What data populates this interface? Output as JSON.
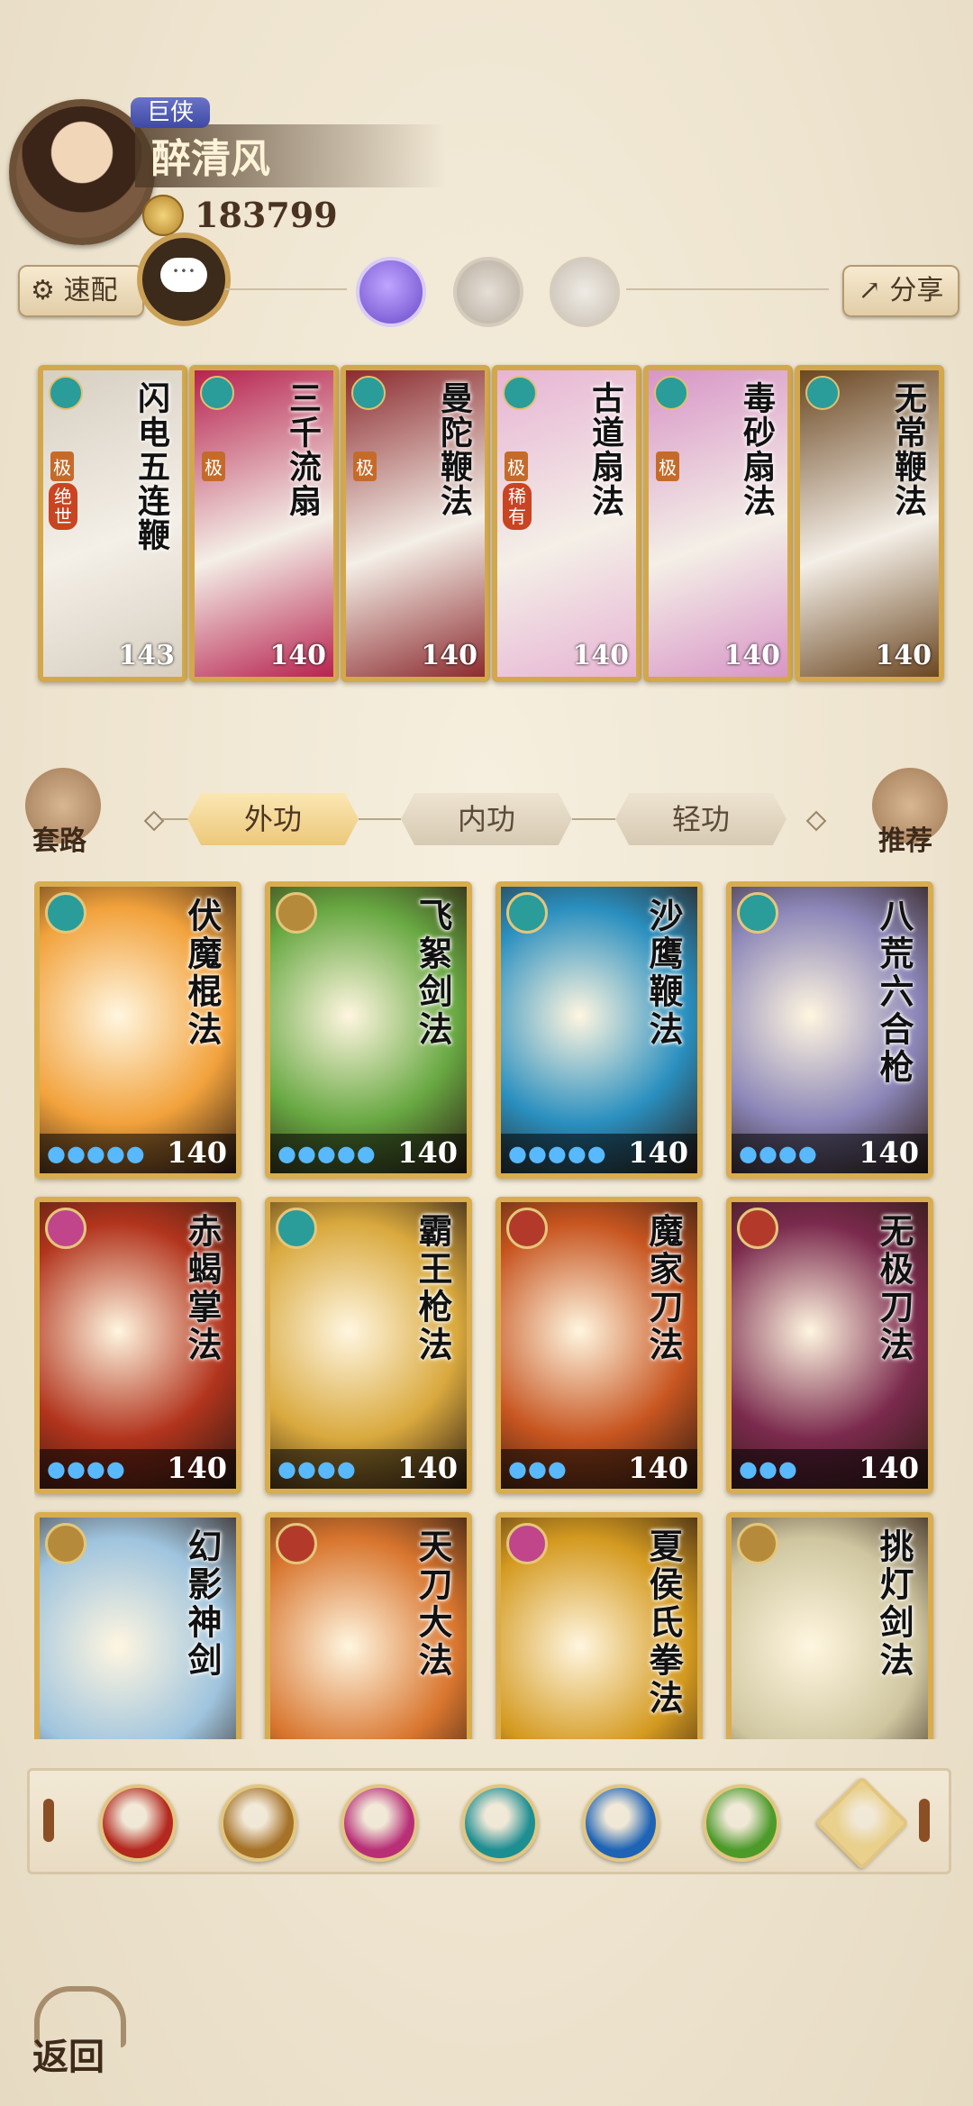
{
  "player": {
    "title_badge": "巨侠",
    "name": "醉清风",
    "currency_value": "183799"
  },
  "controls": {
    "quick_label": "速配",
    "share_label": "分享",
    "category_tabs": [
      "外功",
      "内功",
      "轻功"
    ],
    "routine_label": "套路",
    "recommend_label": "推荐",
    "back_label": "返回"
  },
  "equipped_skills": [
    {
      "name": "闪电五连鞭",
      "level": "143",
      "tag": "极",
      "tag2": "绝世",
      "color": "#d7cfc2"
    },
    {
      "name": "三千流扇",
      "level": "140",
      "tag": "极",
      "tag2": "",
      "color": "#b7224f"
    },
    {
      "name": "曼陀鞭法",
      "level": "140",
      "tag": "极",
      "tag2": "",
      "color": "#8c2b2f"
    },
    {
      "name": "古道扇法",
      "level": "140",
      "tag": "极",
      "tag2": "稀有",
      "color": "#e7b4d4"
    },
    {
      "name": "毒砂扇法",
      "level": "140",
      "tag": "极",
      "tag2": "",
      "color": "#d895c7"
    },
    {
      "name": "无常鞭法",
      "level": "140",
      "tag": "",
      "tag2": "",
      "color": "#6b4722"
    }
  ],
  "skills": [
    {
      "name": "伏魔棍法",
      "level": "140",
      "dots": "●●●●●",
      "color": "#f2a23c",
      "emblem": "#2a9c9a"
    },
    {
      "name": "飞絮剑法",
      "level": "140",
      "dots": "●●●●●",
      "color": "#68a842",
      "emblem": "#b58b3b"
    },
    {
      "name": "沙鹰鞭法",
      "level": "140",
      "dots": "●●●●●",
      "color": "#2a8fbf",
      "emblem": "#2a9c9a"
    },
    {
      "name": "八荒六合枪",
      "level": "140",
      "dots": "●●●●",
      "color": "#8b86b8",
      "emblem": "#2a9c9a"
    },
    {
      "name": "赤蝎掌法",
      "level": "140",
      "dots": "●●●●",
      "color": "#b2341d",
      "emblem": "#c0458b"
    },
    {
      "name": "霸王枪法",
      "level": "140",
      "dots": "●●●●",
      "color": "#d9a93e",
      "emblem": "#2a9c9a"
    },
    {
      "name": "魔家刀法",
      "level": "140",
      "dots": "●●●",
      "color": "#c75520",
      "emblem": "#b33a2a"
    },
    {
      "name": "无极刀法",
      "level": "140",
      "dots": "●●●",
      "color": "#7b2a4d",
      "emblem": "#b33a2a"
    },
    {
      "name": "幻影神剑",
      "level": "",
      "dots": "",
      "color": "#9fc4de",
      "emblem": "#b58b3b"
    },
    {
      "name": "天刀大法",
      "level": "",
      "dots": "",
      "color": "#d8752e",
      "emblem": "#b33a2a"
    },
    {
      "name": "夏侯氏拳法",
      "level": "",
      "dots": "",
      "color": "#d49a20",
      "emblem": "#c0458b"
    },
    {
      "name": "挑灯剑法",
      "level": "",
      "dots": "",
      "color": "#cfc6a0",
      "emblem": "#b58b3b"
    }
  ],
  "filters": [
    {
      "icon": "saber-icon",
      "color": "#b3281f"
    },
    {
      "icon": "sword-icon",
      "color": "#a57228"
    },
    {
      "icon": "palm-icon",
      "color": "#b82f78"
    },
    {
      "icon": "fan-icon",
      "color": "#1d8e92"
    },
    {
      "icon": "yinyang-icon",
      "color": "#1e63b5"
    },
    {
      "icon": "whip-icon",
      "color": "#4c9a2a"
    },
    {
      "icon": "all-icon",
      "color": "#e9d08c"
    }
  ]
}
